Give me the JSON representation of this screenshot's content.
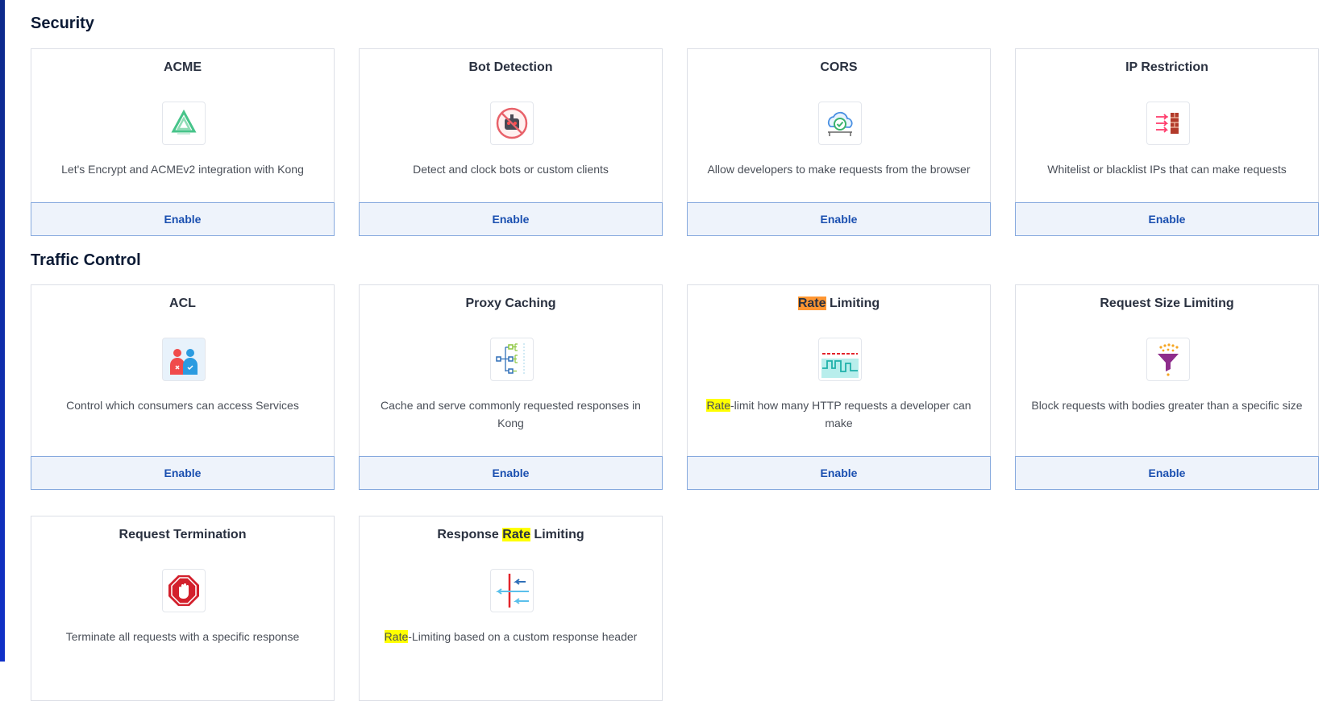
{
  "colors": {
    "accent": "#1a4fb0",
    "button_bg": "#eef3fb",
    "button_border": "#86a9de",
    "highlight": "#ffff00",
    "highlight_active": "#ff9632"
  },
  "sections": [
    {
      "title": "Security",
      "cards": [
        {
          "title_pre": "ACME",
          "title_hl": "",
          "title_post": "",
          "icon": "acme-icon",
          "desc_pre": "Let's Encrypt and ACMEv2 integration with Kong",
          "desc_hl": "",
          "desc_post": "",
          "button": "Enable"
        },
        {
          "title_pre": "Bot Detection",
          "title_hl": "",
          "title_post": "",
          "icon": "bot-detection-icon",
          "desc_pre": "Detect and clock bots or custom clients",
          "desc_hl": "",
          "desc_post": "",
          "button": "Enable"
        },
        {
          "title_pre": "CORS",
          "title_hl": "",
          "title_post": "",
          "icon": "cors-icon",
          "desc_pre": "Allow developers to make requests from the browser",
          "desc_hl": "",
          "desc_post": "",
          "button": "Enable"
        },
        {
          "title_pre": "IP Restriction",
          "title_hl": "",
          "title_post": "",
          "icon": "ip-restriction-icon",
          "desc_pre": "Whitelist or blacklist IPs that can make requests",
          "desc_hl": "",
          "desc_post": "",
          "button": "Enable"
        }
      ]
    },
    {
      "title": "Traffic Control",
      "cards": [
        {
          "title_pre": "ACL",
          "title_hl": "",
          "title_post": "",
          "icon": "acl-icon",
          "desc_pre": "Control which consumers can access Services",
          "desc_hl": "",
          "desc_post": "",
          "button": "Enable"
        },
        {
          "title_pre": "Proxy Caching",
          "title_hl": "",
          "title_post": "",
          "icon": "proxy-caching-icon",
          "desc_pre": "Cache and serve commonly requested responses in Kong",
          "desc_hl": "",
          "desc_post": "",
          "button": "Enable"
        },
        {
          "title_pre": "",
          "title_hl": "Rate",
          "title_post": " Limiting",
          "icon": "rate-limiting-icon",
          "desc_pre": "",
          "desc_hl": "Rate",
          "desc_post": "-limit how many HTTP requests a developer can make",
          "button": "Enable"
        },
        {
          "title_pre": "Request Size Limiting",
          "title_hl": "",
          "title_post": "",
          "icon": "request-size-limiting-icon",
          "desc_pre": "Block requests with bodies greater than a specific size",
          "desc_hl": "",
          "desc_post": "",
          "button": "Enable"
        },
        {
          "title_pre": "Request Termination",
          "title_hl": "",
          "title_post": "",
          "icon": "request-termination-icon",
          "desc_pre": "Terminate all requests with a specific response",
          "desc_hl": "",
          "desc_post": "",
          "button": ""
        },
        {
          "title_pre": "Response ",
          "title_hl": "Rate",
          "title_post": " Limiting",
          "icon": "response-rate-limiting-icon",
          "desc_pre": "",
          "desc_hl": "Rate",
          "desc_post": "-Limiting based on a custom response header",
          "button": ""
        }
      ]
    }
  ]
}
